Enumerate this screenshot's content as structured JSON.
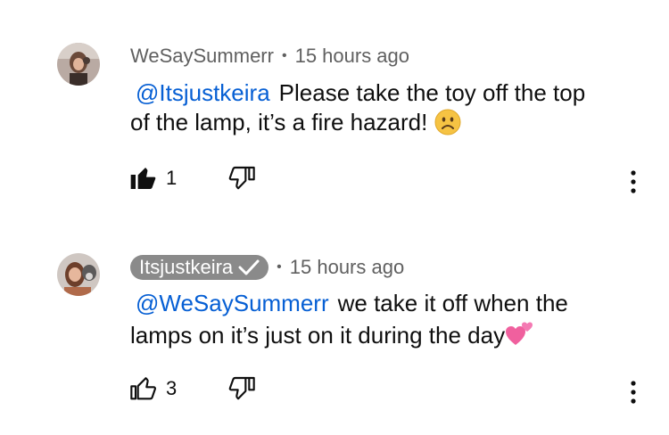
{
  "comments": [
    {
      "author": "WeSaySummerr",
      "time": "15 hours ago",
      "mention": "@Itsjustkeira",
      "text_line1": "Please take the toy off the top",
      "text_line2": "of the lamp, it’s a fire hazard!",
      "emoji_icon": "frowning-face-icon",
      "likes": "1",
      "liked": true
    },
    {
      "author": "Itsjustkeira",
      "author_is_creator": true,
      "time": "15 hours ago",
      "mention": "@WeSaySummerr",
      "text_line1": "we take it off when the",
      "text_line2": "lamps on it’s just on it during the day",
      "emoji_icon": "two-hearts-icon",
      "likes": "3",
      "liked": false
    }
  ],
  "colors": {
    "mention": "#065fd4",
    "meta": "#606060",
    "creator_badge": "#8a8a8a"
  }
}
